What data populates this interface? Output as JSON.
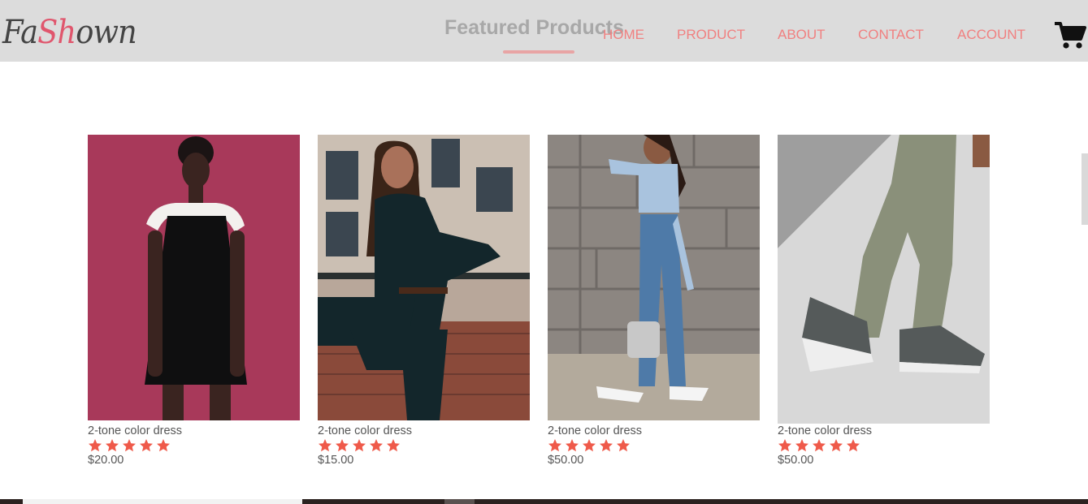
{
  "brand": {
    "logo_part1": "Fa",
    "logo_part2": "Sh",
    "logo_part3": "own"
  },
  "section": {
    "title": "Featured Products"
  },
  "nav": {
    "items": [
      "HOME",
      "PRODUCT",
      "ABOUT",
      "CONTACT",
      "ACCOUNT"
    ]
  },
  "cart": {
    "icon": "cart-icon"
  },
  "colors": {
    "header_bg": "#dcdcdc",
    "nav": "#f08080",
    "star": "#ef5a4a",
    "accent": "#e0566d"
  },
  "products": [
    {
      "name": "2-tone color dress",
      "rating": 5,
      "price": "$20.00"
    },
    {
      "name": "2-tone color dress",
      "rating": 5,
      "price": "$15.00"
    },
    {
      "name": "2-tone color dress",
      "rating": 5,
      "price": "$50.00"
    },
    {
      "name": "2-tone color dress",
      "rating": 5,
      "price": "$50.00"
    }
  ]
}
